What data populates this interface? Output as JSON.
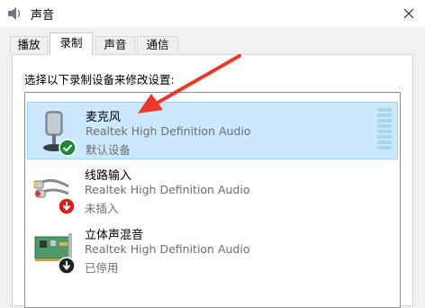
{
  "window": {
    "title": "声音",
    "close_label": "✕"
  },
  "tabs": [
    {
      "label": "播放"
    },
    {
      "label": "录制"
    },
    {
      "label": "声音"
    },
    {
      "label": "通信"
    }
  ],
  "instruction": "选择以下录制设备来修改设置:",
  "devices": [
    {
      "name": "麦克风",
      "driver": "Realtek High Definition Audio",
      "status": "默认设备",
      "icon": "microphone-icon",
      "badge": "check-badge-icon"
    },
    {
      "name": "线路输入",
      "driver": "Realtek High Definition Audio",
      "status": "未插入",
      "icon": "line-in-icon",
      "badge": "unplugged-badge-icon"
    },
    {
      "name": "立体声混音",
      "driver": "Realtek High Definition Audio",
      "status": "已停用",
      "icon": "sound-card-icon",
      "badge": "disabled-badge-icon"
    }
  ],
  "colors": {
    "selection_bg": "#cce8ff",
    "annotation_arrow": "#e8392c",
    "default_badge": "#1a8a3a",
    "unplugged_badge": "#d42020"
  }
}
